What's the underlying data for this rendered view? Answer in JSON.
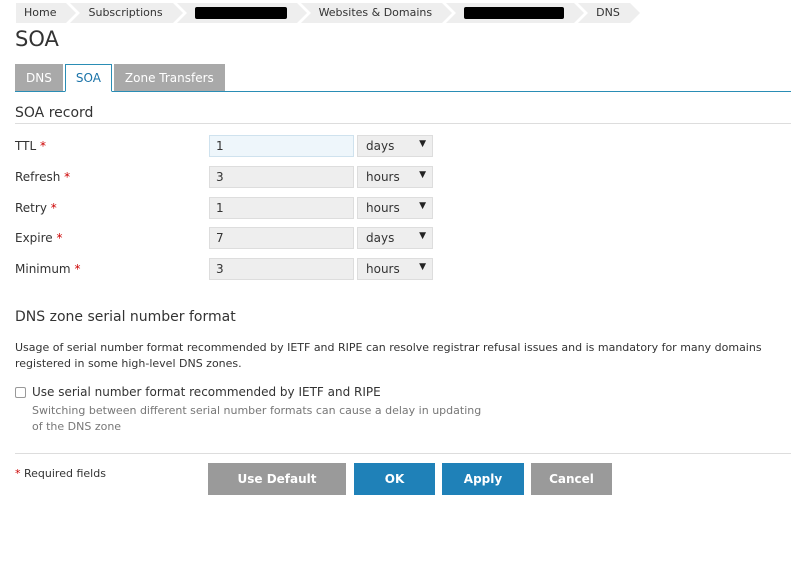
{
  "breadcrumb": {
    "items": [
      "Home",
      "Subscriptions",
      "Websites & Domains",
      "DNS"
    ]
  },
  "page": {
    "title": "SOA"
  },
  "tabs": [
    {
      "label": "DNS",
      "active": false
    },
    {
      "label": "SOA",
      "active": true
    },
    {
      "label": "Zone Transfers",
      "active": false
    }
  ],
  "soa": {
    "section_title": "SOA record",
    "fields": [
      {
        "label": "TTL",
        "value": "1",
        "unit": "days"
      },
      {
        "label": "Refresh",
        "value": "3",
        "unit": "hours"
      },
      {
        "label": "Retry",
        "value": "1",
        "unit": "hours"
      },
      {
        "label": "Expire",
        "value": "7",
        "unit": "days"
      },
      {
        "label": "Minimum",
        "value": "3",
        "unit": "hours"
      }
    ],
    "required_mark": "*"
  },
  "serial": {
    "section_title": "DNS zone serial number format",
    "description": "Usage of serial number format recommended by IETF and RIPE can resolve registrar refusal issues and is mandatory for many domains registered in some high-level DNS zones.",
    "checkbox_label": "Use serial number format recommended by IETF and RIPE",
    "checkbox_checked": false,
    "hint": "Switching between different serial number formats can cause a delay in updating of the DNS zone"
  },
  "footer": {
    "required_fields": "Required fields",
    "buttons": {
      "default": "Use Default Settings",
      "ok": "OK",
      "apply": "Apply",
      "cancel": "Cancel"
    }
  },
  "colors": {
    "accent": "#1f81b8",
    "tab_inactive": "#a9a9a9",
    "required": "#cc0000"
  }
}
